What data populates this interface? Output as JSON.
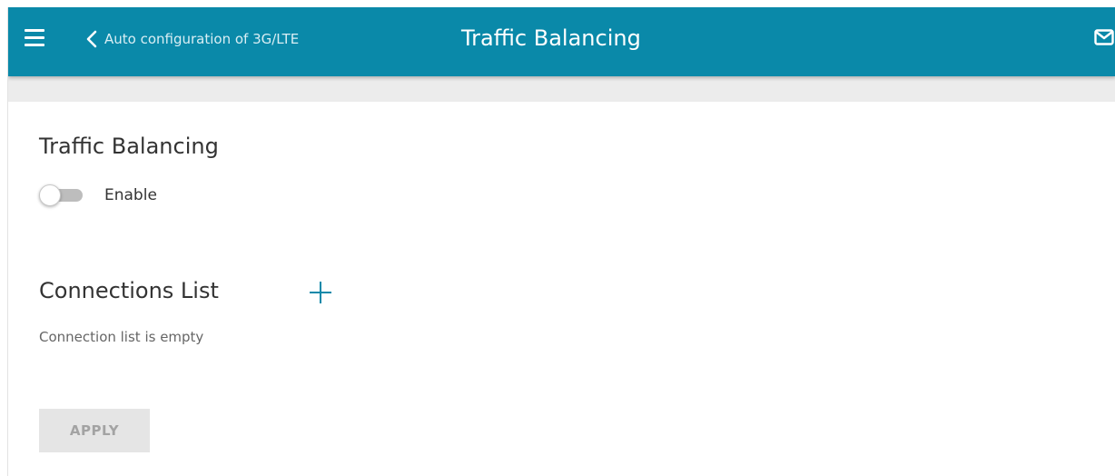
{
  "header": {
    "back_link": "Auto configuration of 3G/LTE",
    "title": "Traffic Balancing",
    "accent_color": "#0a89a9",
    "icons": {
      "menu": "menu-icon",
      "back": "chevron-left-icon",
      "mail": "mail-icon"
    }
  },
  "traffic_section": {
    "title": "Traffic Balancing",
    "toggle_label": "Enable",
    "toggle_enabled": false
  },
  "connections_section": {
    "title": "Connections List",
    "add_icon": "plus-icon",
    "empty_text": "Connection list is empty"
  },
  "actions": {
    "apply_label": "APPLY",
    "apply_disabled": true
  }
}
